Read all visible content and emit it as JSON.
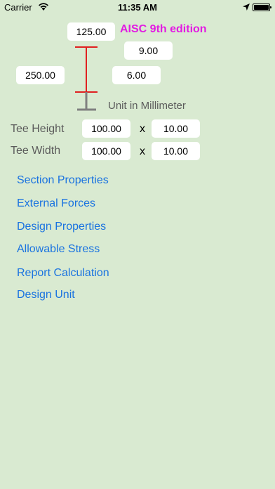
{
  "status_bar": {
    "carrier": "Carrier",
    "time": "11:35 AM"
  },
  "diagram": {
    "flange_width": "125.00",
    "flange_thickness": "9.00",
    "depth": "250.00",
    "web_thickness": "6.00",
    "edition": "AISC 9th edition",
    "unit_label": "Unit in Millimeter",
    "colors": {
      "edition": "#e21be2",
      "section_red": "#e02020",
      "section_gray": "#808080"
    }
  },
  "tee": {
    "height_label": "Tee Height",
    "height_value": "100.00",
    "height_thickness": "10.00",
    "width_label": "Tee Width",
    "width_value": "100.00",
    "width_thickness": "10.00",
    "times": "x"
  },
  "menu": {
    "section_properties": "Section Properties",
    "external_forces": "External Forces",
    "design_properties": "Design Properties",
    "allowable_stress": "Allowable Stress",
    "report_calculation": "Report Calculation",
    "design_unit": "Design Unit"
  }
}
